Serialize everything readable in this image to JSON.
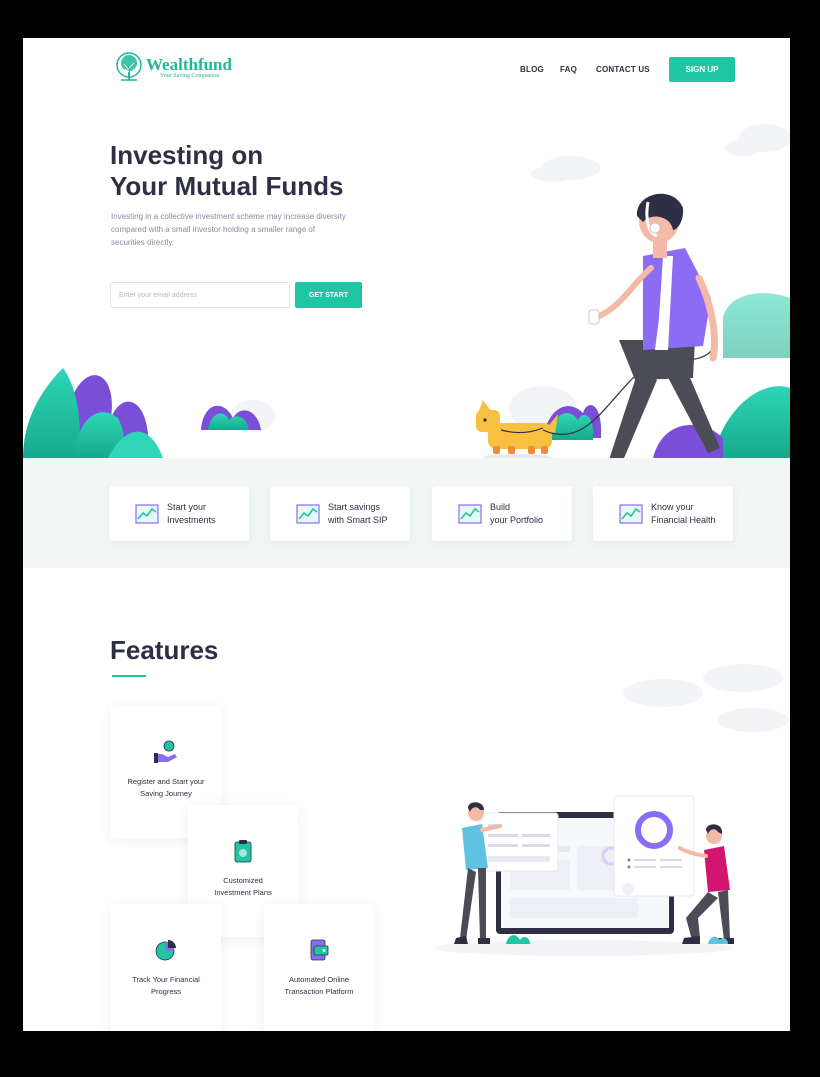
{
  "brand": {
    "name": "Wealthfund",
    "tagline": "Your Saving Companion"
  },
  "nav": {
    "blog": "BLOG",
    "faq": "FAQ",
    "contact": "CONTACT US",
    "signup": "SIGN UP"
  },
  "hero": {
    "title_line1": "Investing on",
    "title_line2": "Your Mutual Funds",
    "description": "Investing in a collective investment scheme may increase diversity compared with a small investor holding a smaller range of securities directly.",
    "email_placeholder": "Enter your email address",
    "cta": "GET START"
  },
  "quick_links": [
    {
      "line1": "Start your",
      "line2": "Investments"
    },
    {
      "line1": "Start savings",
      "line2": "with Smart SIP"
    },
    {
      "line1": "Build",
      "line2": "your Portfolio"
    },
    {
      "line1": "Know your",
      "line2": "Financial Health"
    }
  ],
  "features": {
    "title": "Features",
    "items": [
      {
        "line1": "Register and Start your",
        "line2": "Saving Journey",
        "icon": "hand-coin-icon"
      },
      {
        "line1": "Customized",
        "line2": "Investment Plans",
        "icon": "clipboard-icon"
      },
      {
        "line1": "Track Your Financial",
        "line2": "Progress",
        "icon": "pie-chart-icon"
      },
      {
        "line1": "Automated Online",
        "line2": "Transaction Platform",
        "icon": "wallet-device-icon"
      }
    ]
  },
  "colors": {
    "accent": "#1fc6a4",
    "text": "#2e2f45",
    "purple": "#8a6cf5",
    "magenta": "#d4156f"
  }
}
